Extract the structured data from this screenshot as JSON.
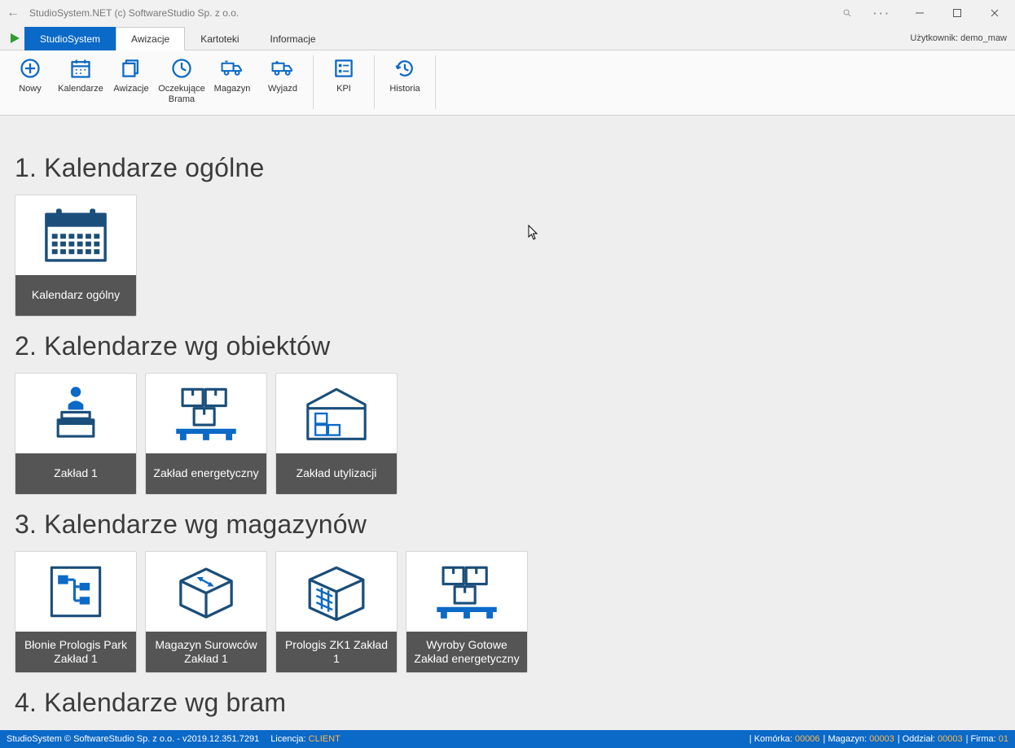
{
  "window": {
    "title": "StudioSystem.NET (c) SoftwareStudio Sp. z o.o."
  },
  "tabs": {
    "primary": "StudioSystem",
    "items": [
      "Awizacje",
      "Kartoteki",
      "Informacje"
    ],
    "user_label": "Użytkownik: demo_maw"
  },
  "ribbon": {
    "group1": [
      {
        "label": "Nowy",
        "icon": "plus-circle-icon"
      },
      {
        "label": "Kalendarze",
        "icon": "calendar-icon"
      },
      {
        "label": "Awizacje",
        "icon": "copy-icon"
      },
      {
        "label": "Oczekujące\nBrama",
        "icon": "clock-icon"
      },
      {
        "label": "Magazyn",
        "icon": "truck-in-icon"
      },
      {
        "label": "Wyjazd",
        "icon": "truck-out-icon"
      }
    ],
    "group2": [
      {
        "label": "KPI",
        "icon": "kpi-icon"
      }
    ],
    "group3": [
      {
        "label": "Historia",
        "icon": "history-icon"
      }
    ]
  },
  "sections": [
    {
      "title": "1. Kalendarze ogólne",
      "tiles": [
        {
          "label": "Kalendarz ogólny",
          "icon": "calendar-large-icon"
        }
      ]
    },
    {
      "title": "2. Kalendarze wg obiektów",
      "tiles": [
        {
          "label": "Zakład 1",
          "icon": "podium-icon"
        },
        {
          "label": "Zakład energetyczny",
          "icon": "pallet-boxes-icon"
        },
        {
          "label": "Zakład utylizacji",
          "icon": "warehouse-icon"
        }
      ]
    },
    {
      "title": "3. Kalendarze wg magazynów",
      "tiles": [
        {
          "label": "Błonie Prologis Park Zakład 1",
          "icon": "flowchart-icon"
        },
        {
          "label": "Magazyn Surowców Zakład 1",
          "icon": "box-arrows-icon"
        },
        {
          "label": "Prologis ZK1 Zakład 1",
          "icon": "building-icon"
        },
        {
          "label": "Wyroby Gotowe Zakład energetyczny",
          "icon": "pallet-boxes-icon"
        }
      ]
    },
    {
      "title": "4. Kalendarze wg bram",
      "tiles": []
    }
  ],
  "statusbar": {
    "left1": "StudioSystem © SoftwareStudio Sp. z o.o. - v2019.12.351.7291",
    "lic_label": "Licencja:",
    "lic_value": "CLIENT",
    "right": [
      {
        "label": "Komórka:",
        "value": "00006"
      },
      {
        "label": "Magazyn:",
        "value": "00003"
      },
      {
        "label": "Oddział:",
        "value": "00003"
      },
      {
        "label": "Firma:",
        "value": "01"
      }
    ]
  }
}
